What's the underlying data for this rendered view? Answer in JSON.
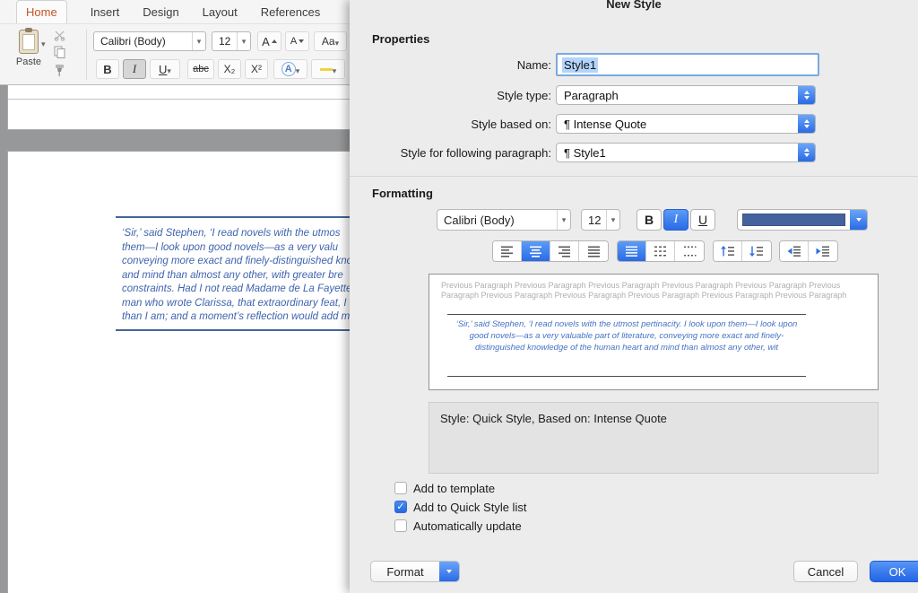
{
  "colors": {
    "accent_blue": "#2e6fe4",
    "quote_blue": "#3f63ae",
    "selection_blue": "#b3d4fc",
    "home_tab_orange": "#c35427",
    "font_swatch_navy": "#44629e"
  },
  "ribbon": {
    "tabs": [
      {
        "label": "Home",
        "active": true
      },
      {
        "label": "Insert",
        "active": false
      },
      {
        "label": "Design",
        "active": false
      },
      {
        "label": "Layout",
        "active": false
      },
      {
        "label": "References",
        "active": false
      }
    ],
    "clipboard_group": {
      "paste_label": "Paste"
    },
    "font_group": {
      "font_name": "Calibri (Body)",
      "font_size": "12",
      "grow_font": "A",
      "shrink_font": "A",
      "change_case": "Aa",
      "bold": "B",
      "italic": "I",
      "underline": "U",
      "strikethrough": "abc",
      "subscript": "X₂",
      "superscript": "X²",
      "text_effects": "A"
    }
  },
  "document": {
    "quote_lines": [
      "‘Sir,’ said Stephen, ‘I read novels with the utmos",
      "them—I look upon good novels—as a very valu",
      "conveying more exact and finely-distinguished kno",
      "and mind than almost any other, with greater bre",
      "constraints. Had I not read Madame de La Fayette,",
      "man who wrote Clarissa, that extraordinary feat, I s",
      "than I am; and a moment’s reflection would add m"
    ]
  },
  "dialog": {
    "title": "New Style",
    "properties": {
      "section_label": "Properties",
      "name_label": "Name:",
      "name_value": "Style1",
      "style_type_label": "Style type:",
      "style_type_value": "Paragraph",
      "based_on_label": "Style based on:",
      "based_on_value": "¶ Intense Quote",
      "following_label": "Style for following paragraph:",
      "following_value": "¶ Style1"
    },
    "formatting": {
      "section_label": "Formatting",
      "font_name": "Calibri (Body)",
      "font_size": "12",
      "bold": "B",
      "italic": "I",
      "underline": "U"
    },
    "preview": {
      "previous_text": "Previous Paragraph Previous Paragraph Previous Paragraph Previous Paragraph Previous Paragraph Previous Paragraph Previous Paragraph Previous Paragraph Previous Paragraph Previous Paragraph Previous Paragraph",
      "quote_text": "‘Sir,’ said Stephen, ‘I read novels with the utmost pertinacity. I look upon them—I look upon good novels—as a very valuable part of literature, conveying more exact and finely-distinguished knowledge of the human heart and mind than almost any other, wit"
    },
    "description": "Style: Quick Style, Based on: Intense Quote",
    "checkboxes": [
      {
        "label": "Add to template",
        "checked": false
      },
      {
        "label": "Add to Quick Style list",
        "checked": true
      },
      {
        "label": "Automatically update",
        "checked": false
      }
    ],
    "footer": {
      "format": "Format",
      "cancel": "Cancel",
      "ok": "OK"
    }
  }
}
